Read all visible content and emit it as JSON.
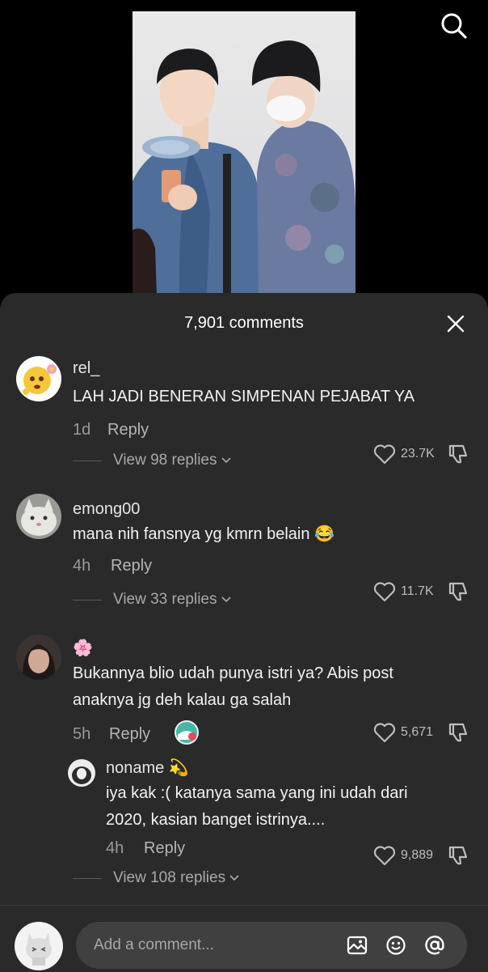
{
  "sheet": {
    "title": "7,901 comments"
  },
  "comments": [
    {
      "username": "rel_",
      "lines": [
        "LAH JADI BENERAN SIMPENAN PEJABAT YA"
      ],
      "time": "1d",
      "reply_label": "Reply",
      "likes": "23.7K",
      "view_replies": "View 98 replies"
    },
    {
      "username": "emong00",
      "lines": [
        "mana nih fansnya yg kmrn belain 😂"
      ],
      "time": "4h",
      "reply_label": "Reply",
      "likes": "11.7K",
      "view_replies": "View 33 replies"
    },
    {
      "username": "🌸",
      "lines": [
        "Bukannya blio udah punya istri ya? Abis post",
        "anaknya jg deh kalau ga salah"
      ],
      "time": "5h",
      "reply_label": "Reply",
      "likes": "5,671",
      "view_replies": "View 108 replies",
      "nested_reply": {
        "username": "noname 💫",
        "lines": [
          "iya kak :( katanya sama yang ini udah dari",
          "2020, kasian banget istrinya...."
        ],
        "time": "4h",
        "reply_label": "Reply",
        "likes": "9,889"
      }
    }
  ],
  "input": {
    "placeholder": "Add a comment..."
  },
  "icons": {
    "search": "search-icon",
    "close": "close-icon",
    "like": "heart-outline-icon",
    "dislike": "thumbs-down-icon",
    "chevron": "chevron-down-icon",
    "image": "image-icon",
    "emoji": "emoji-icon",
    "mention": "at-sign-icon"
  },
  "colors": {
    "sheet_bg": "#2a2a2a",
    "input_bg": "#404040",
    "text": "#f2f2f2",
    "muted": "#9a9a9a"
  }
}
